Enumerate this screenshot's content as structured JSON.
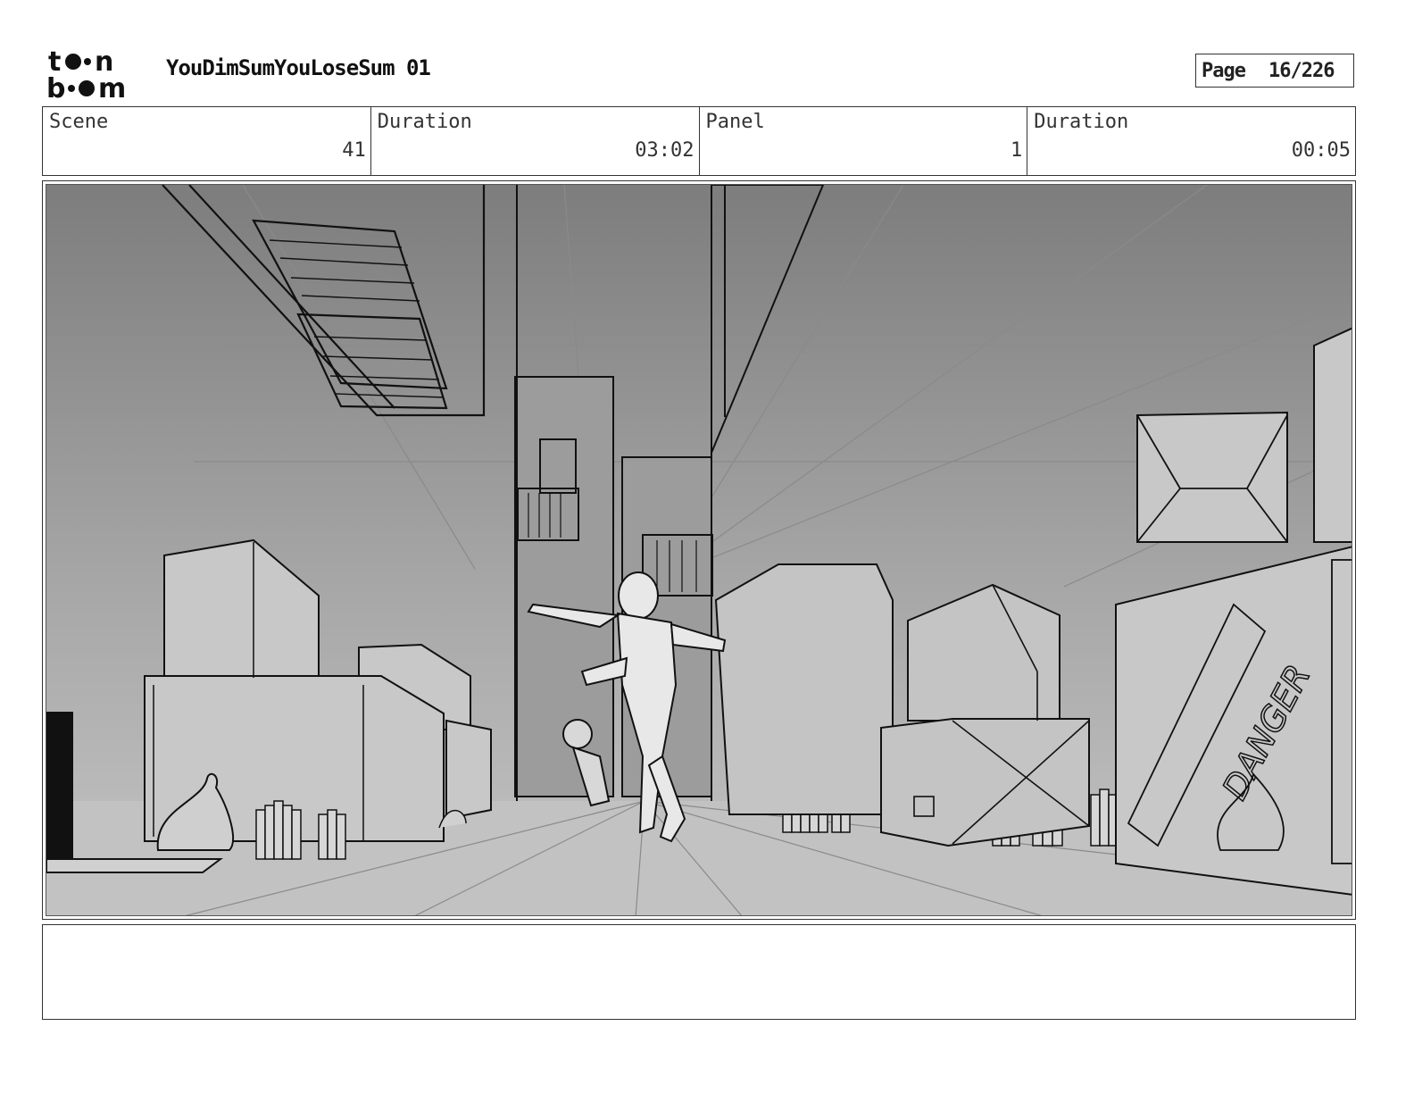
{
  "header": {
    "brand": "toon boom",
    "title": "YouDimSumYouLoseSum 01",
    "page_label": "Page",
    "page_number": "16/226"
  },
  "info": {
    "scene_label": "Scene",
    "scene_value": "41",
    "scene_duration_label": "Duration",
    "scene_duration_value": "03:02",
    "panel_label": "Panel",
    "panel_value": "1",
    "panel_duration_label": "Duration",
    "panel_duration_value": "00:05"
  },
  "panel": {
    "sign_text": "DANGER"
  },
  "notes": {
    "text": ""
  }
}
